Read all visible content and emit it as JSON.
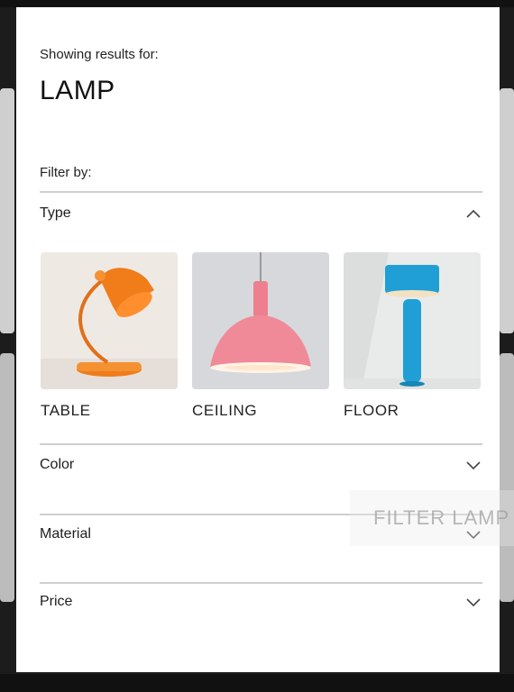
{
  "header": {
    "showing_label": "Showing results for:",
    "query": "LAMP"
  },
  "filter": {
    "filter_by_label": "Filter by:",
    "sections": [
      {
        "label": "Type",
        "expanded": true
      },
      {
        "label": "Color",
        "expanded": false
      },
      {
        "label": "Material",
        "expanded": false
      },
      {
        "label": "Price",
        "expanded": false
      }
    ],
    "type_options": [
      {
        "label": "TABLE",
        "image": "orange-table-lamp"
      },
      {
        "label": "CEILING",
        "image": "pink-ceiling-lamp"
      },
      {
        "label": "FLOOR",
        "image": "blue-floor-lamp"
      }
    ]
  },
  "overlay": {
    "label": "FILTER LAMP"
  },
  "colors": {
    "modal_bg": "#ffffff",
    "backdrop": "#1c1c1c",
    "divider": "#cfcfcf",
    "table_lamp": "#f07c1a",
    "ceiling_lamp": "#ee7f8e",
    "floor_lamp": "#1f9fd6"
  }
}
